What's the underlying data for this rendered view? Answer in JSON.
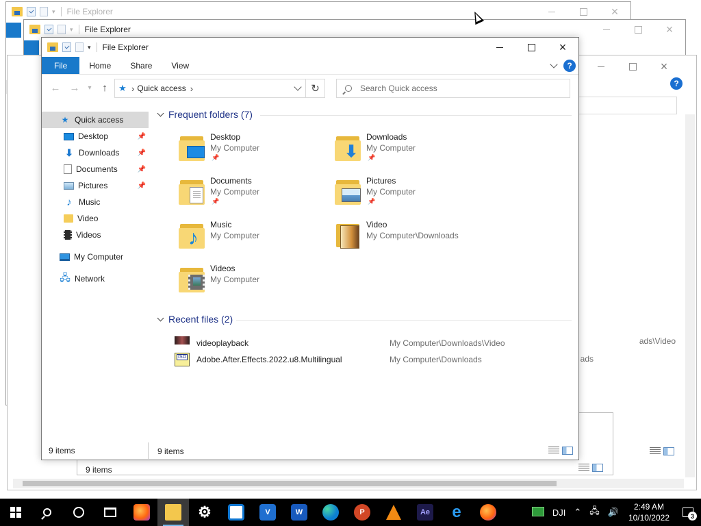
{
  "app_title": "File Explorer",
  "background_windows": [
    {
      "title": "File Explorer",
      "status": "9 i"
    },
    {
      "title": "File Explorer",
      "status": "9 i"
    },
    {
      "title": "",
      "status": "9 items"
    },
    {
      "title": "",
      "status": "9 items"
    }
  ],
  "background_partial_text": [
    "ads\\Video",
    "ads",
    "9 i"
  ],
  "ribbon": {
    "tabs": [
      {
        "label": "File"
      },
      {
        "label": "Home"
      },
      {
        "label": "Share"
      },
      {
        "label": "View"
      }
    ],
    "help_icon": "?"
  },
  "address_bar": {
    "root_icon": "quick-access-star",
    "path": "Quick access",
    "refresh_icon": "↻"
  },
  "search": {
    "placeholder": "Search Quick access"
  },
  "nav_pane": {
    "items": [
      {
        "label": "Quick access",
        "icon": "quick-access-star",
        "selected": true,
        "pinned": false
      },
      {
        "label": "Desktop",
        "icon": "desktop-icon",
        "pinned": true
      },
      {
        "label": "Downloads",
        "icon": "downloads-icon",
        "pinned": true
      },
      {
        "label": "Documents",
        "icon": "documents-icon",
        "pinned": true
      },
      {
        "label": "Pictures",
        "icon": "pictures-icon",
        "pinned": true
      },
      {
        "label": "Music",
        "icon": "music-icon",
        "pinned": false
      },
      {
        "label": "Video",
        "icon": "folder-icon",
        "pinned": false
      },
      {
        "label": "Videos",
        "icon": "videos-icon",
        "pinned": false
      },
      {
        "label": "My Computer",
        "icon": "computer-icon",
        "pinned": false
      },
      {
        "label": "Network",
        "icon": "network-icon",
        "pinned": false
      }
    ]
  },
  "frequent_folders": {
    "heading": "Frequent folders (7)",
    "items": [
      {
        "name": "Desktop",
        "location": "My Computer",
        "pinned": true,
        "icon": "desktop-folder-icon"
      },
      {
        "name": "Downloads",
        "location": "My Computer",
        "pinned": true,
        "icon": "downloads-folder-icon"
      },
      {
        "name": "Documents",
        "location": "My Computer",
        "pinned": true,
        "icon": "documents-folder-icon"
      },
      {
        "name": "Pictures",
        "location": "My Computer",
        "pinned": true,
        "icon": "pictures-folder-icon"
      },
      {
        "name": "Music",
        "location": "My Computer",
        "pinned": false,
        "icon": "music-folder-icon"
      },
      {
        "name": "Video",
        "location": "My Computer\\Downloads",
        "pinned": false,
        "icon": "vlc-folder-icon"
      },
      {
        "name": "Videos",
        "location": "My Computer",
        "pinned": false,
        "icon": "videos-folder-icon"
      }
    ]
  },
  "recent_files": {
    "heading": "Recent files (2)",
    "items": [
      {
        "name": "videoplayback",
        "location": "My Computer\\Downloads\\Video",
        "icon": "video-file-icon"
      },
      {
        "name": "Adobe.After.Effects.2022.u8.Multilingual",
        "location": "My Computer\\Downloads",
        "icon": "iso-file-icon"
      }
    ]
  },
  "status": {
    "count": "9 items"
  },
  "taskbar": {
    "apps": [
      {
        "name": "Firefox",
        "icon": "firefox-icon"
      },
      {
        "name": "File Explorer",
        "icon": "file-explorer-icon",
        "active": true
      },
      {
        "name": "Settings",
        "icon": "settings-icon"
      },
      {
        "name": "Microsoft Store",
        "icon": "store-icon"
      },
      {
        "name": "Visual Studio",
        "icon": "visual-studio-icon"
      },
      {
        "name": "Word",
        "icon": "word-icon"
      },
      {
        "name": "Edge",
        "icon": "edge-icon"
      },
      {
        "name": "PowerPoint",
        "icon": "powerpoint-icon"
      },
      {
        "name": "VLC",
        "icon": "vlc-icon"
      },
      {
        "name": "After Effects",
        "icon": "after-effects-icon"
      },
      {
        "name": "Internet Explorer",
        "icon": "ie-icon"
      },
      {
        "name": "Firefox",
        "icon": "firefox-icon"
      }
    ],
    "tray": {
      "dji_label": "DJI",
      "time": "2:49 AM",
      "date": "10/10/2022",
      "notifications": "3"
    }
  },
  "colors": {
    "accent": "#1979ca",
    "group_heading": "#1e3287",
    "taskbar": "#000000"
  }
}
